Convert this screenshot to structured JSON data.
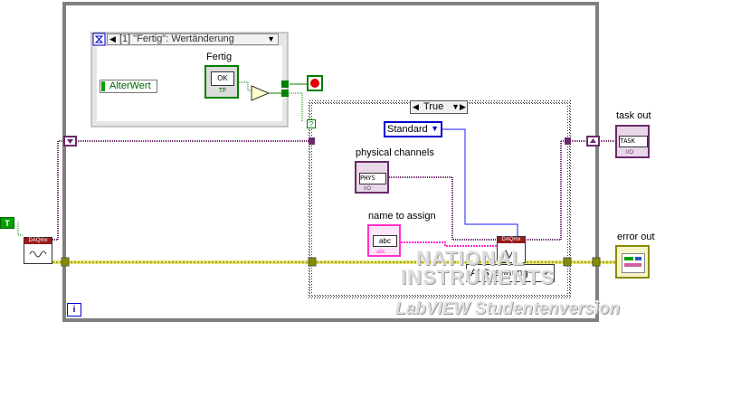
{
  "event_structure": {
    "case_label": "[1] \"Fertig\": Wertänderung",
    "alter_wert": "AlterWert"
  },
  "fertig": {
    "label": "Fertig",
    "button_text": "OK",
    "type_text": "TF"
  },
  "case_structure": {
    "selector": "True",
    "standard": "Standard",
    "physical_channels_label": "physical channels",
    "phys_text": "PHYS",
    "phys_type": "I/O",
    "name_to_assign_label": "name to assign",
    "abc_text": "abc",
    "abc_type": "abc",
    "daqmx_right_text": "DAQmx",
    "ai_spannung": "AI Spannung",
    "question_mark": "?"
  },
  "outer": {
    "daqmx_left_text": "DAQmx",
    "true_const": "T",
    "loop_iteration": "i"
  },
  "terminals": {
    "task_out_label": "task out",
    "task_text": "TASK",
    "task_type": "I/O",
    "error_out_label": "error out"
  },
  "watermark": {
    "line1": "NATIONAL",
    "line2": "INSTRUMENTS",
    "line3": "LabVIEW  Studentenversion"
  },
  "colors": {
    "while_loop": "#808080",
    "wire_task": "#6b2a6b",
    "wire_error": "#c8c800",
    "wire_bool": "#008000",
    "string_pink": "#ff33cc",
    "enum_blue": "#0000cc"
  }
}
